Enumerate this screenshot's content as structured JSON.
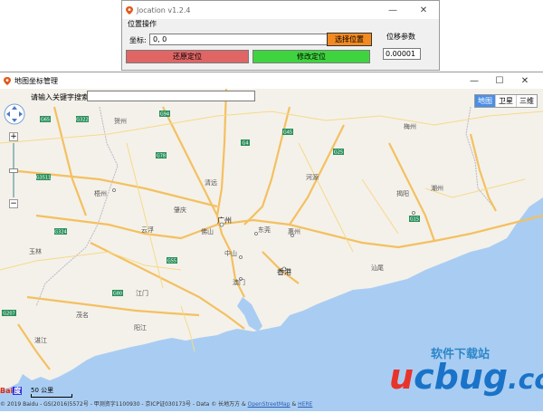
{
  "tool_window": {
    "title": "Jocation v1.2.4",
    "group_label": "位置操作",
    "coord_label": "坐标:",
    "coord_value": "0, 0",
    "pick_button": "选择位置",
    "restore_button": "还原定位",
    "modify_button": "修改定位",
    "offset_label": "位移参数",
    "offset_value": "0.00001",
    "controls": {
      "minimize": "—",
      "close": "✕"
    }
  },
  "map_window": {
    "title": "地图坐标管理",
    "search_label": "请输入关键字搜索",
    "search_value": "",
    "controls": {
      "minimize": "—",
      "maximize": "☐",
      "close": "✕"
    },
    "map_types": [
      "地图",
      "卫星",
      "三维"
    ],
    "map_type_active": "地图",
    "zoom": {
      "plus": "+",
      "minus": "−"
    },
    "scale_label": "50 公里",
    "logo_bai": "Bai",
    "logo_du": "度",
    "footer_text": "© 2019 Baidu - GS(2016)5572号 - 甲测资字1100930 - 京ICP证030173号 - Data © 长地万方 &",
    "footer_link_osm": "OpenStreetMap",
    "footer_amp": "&",
    "footer_link_here": "HERE"
  },
  "map_labels": {
    "cities": [
      "贺州",
      "广州",
      "东莞",
      "惠州",
      "香港",
      "澳门",
      "中山",
      "佛山",
      "江门",
      "梅州",
      "潮州",
      "揭阳",
      "汕尾",
      "河源",
      "清远",
      "云浮",
      "肇庆",
      "梧州",
      "阳江",
      "茂名",
      "湛江",
      "玉林"
    ],
    "routes": [
      "G322",
      "G65",
      "G78",
      "G4",
      "G45",
      "G25",
      "G15",
      "G324",
      "G55",
      "G3511",
      "G80",
      "G207",
      "G94"
    ]
  },
  "watermark": {
    "zh": "软件下载站",
    "u": "u",
    "rest": "cbug",
    "tld": ".cc"
  },
  "colors": {
    "sea": "#a9cdf2",
    "land": "#f4f1ea",
    "highway": "#f4c060",
    "road": "#f7d98a",
    "pick": "#f28a21",
    "restore": "#e06565",
    "modify": "#3fd43f",
    "active_tab": "#4b8ee6"
  }
}
